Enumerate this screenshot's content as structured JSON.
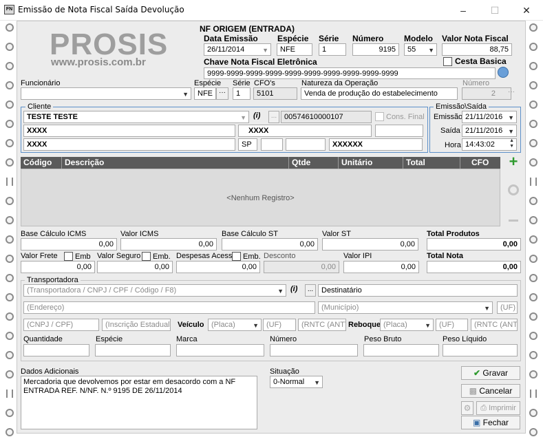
{
  "window": {
    "title": "Emissão de Nota Fiscal Saída Devolução",
    "icon_text": "FN"
  },
  "logo": {
    "brand": "PROSIS",
    "url": "www.prosis.com.br"
  },
  "origem": {
    "title": "NF ORIGEM (ENTRADA)",
    "data_emissao_label": "Data Emissão",
    "data_emissao": "26/11/2014",
    "especie_label": "Espécie",
    "especie": "NFE",
    "serie_label": "Série",
    "serie": "1",
    "numero_label": "Número",
    "numero": "9195",
    "modelo_label": "Modelo",
    "modelo": "55",
    "valor_label": "Valor Nota Fiscal",
    "valor": "88,75",
    "chave_label": "Chave Nota Fiscal Eletrônica",
    "chave": "9999-9999-9999-9999-9999-9999-9999-9999-9999-9999",
    "cesta_label": "Cesta Basica"
  },
  "nota": {
    "funcionario_label": "Funcionário",
    "funcionario": "",
    "especie_label": "Espécie",
    "especie": "NFE",
    "serie_label": "Série",
    "serie": "1",
    "cfos_label": "CFO's",
    "cfos": "5101",
    "natureza_label": "Natureza da Operação",
    "natureza": "Venda de produção do estabelecimento",
    "numero_label": "Número",
    "numero": "2",
    "dots": "···"
  },
  "cliente": {
    "title": "Cliente",
    "nome": "TESTE TESTE",
    "info": "(i)",
    "dots": "...",
    "doc": "00574610000107",
    "cons_final": "Cons. Final",
    "linha1a": "XXXX",
    "linha1b": "XXXX",
    "linha2a": "XXXX",
    "uf": "SP",
    "linha2b": "XXXXXX"
  },
  "emissao_saida": {
    "title": "Emissão\\Saída",
    "emissao_label": "Emissão",
    "emissao": "21/11/2016",
    "saida_label": "Saída",
    "saida": "21/11/2016",
    "hora_label": "Hora",
    "hora": "14:43:02"
  },
  "grid": {
    "columns": [
      "Código",
      "Descrição",
      "Qtde",
      "Unitário",
      "Total",
      "CFO"
    ],
    "empty_text": "<Nenhum Registro>"
  },
  "totais": {
    "base_icms_label": "Base Cálculo ICMS",
    "base_icms": "0,00",
    "valor_icms_label": "Valor ICMS",
    "valor_icms": "0,00",
    "base_st_label": "Base Cálculo ST",
    "base_st": "0,00",
    "valor_st_label": "Valor ST",
    "valor_st": "0,00",
    "total_produtos_label": "Total Produtos",
    "total_produtos": "0,00",
    "frete_label": "Valor Frete",
    "frete": "0,00",
    "emb_label": "Emb",
    "seguro_label": "Valor Seguro",
    "seguro": "0,00",
    "emb2_label": "Emb.",
    "despesas_label": "Despesas Acess.",
    "despesas": "0,00",
    "emb3_label": "Emb.",
    "desconto_label": "Desconto",
    "desconto": "0,00",
    "ipi_label": "Valor IPI",
    "ipi": "0,00",
    "total_nota_label": "Total Nota",
    "total_nota": "0,00"
  },
  "transportadora": {
    "title": "Transportadora",
    "busca_placeholder": "(Transportadora / CNPJ / CPF / Código / F8)",
    "info": "(i)",
    "dots": "...",
    "destinatario": "Destinatário",
    "endereco_placeholder": "(Endereço)",
    "municipio_placeholder": "(Município)",
    "uf_placeholder": "(UF)",
    "cnpj_placeholder": "(CNPJ / CPF)",
    "ie_placeholder": "(Inscrição Estadual)",
    "veiculo_label": "Veículo",
    "placa_placeholder": "(Placa)",
    "uf2_placeholder": "(UF)",
    "rntc_placeholder": "(RNTC (ANTT",
    "reboque_label": "Reboque",
    "placa2_placeholder": "(Placa)",
    "uf3_placeholder": "(UF)",
    "rntc2_placeholder": "(RNTC (ANTT",
    "quantidade_label": "Quantidade",
    "especie_label": "Espécie",
    "marca_label": "Marca",
    "numero_label": "Número",
    "peso_bruto_label": "Peso Bruto",
    "peso_liquido_label": "Peso Líquido"
  },
  "adicionais": {
    "label": "Dados Adicionais",
    "text": "Mercadoria que devolvemos por estar em desacordo com a NF ENTRADA REF. N/NF. N.º 9195 DE 26/11/2014"
  },
  "situacao": {
    "label": "Situação",
    "value": "0-Normal"
  },
  "buttons": {
    "gravar": "Gravar",
    "cancelar": "Cancelar",
    "imprimir": "Imprimir",
    "fechar": "Fechar"
  },
  "colors": {
    "accent": "#5b8fc9",
    "grid_header": "#5a5a5a",
    "panel": "#ececec",
    "add_green": "#2e9a2e"
  }
}
